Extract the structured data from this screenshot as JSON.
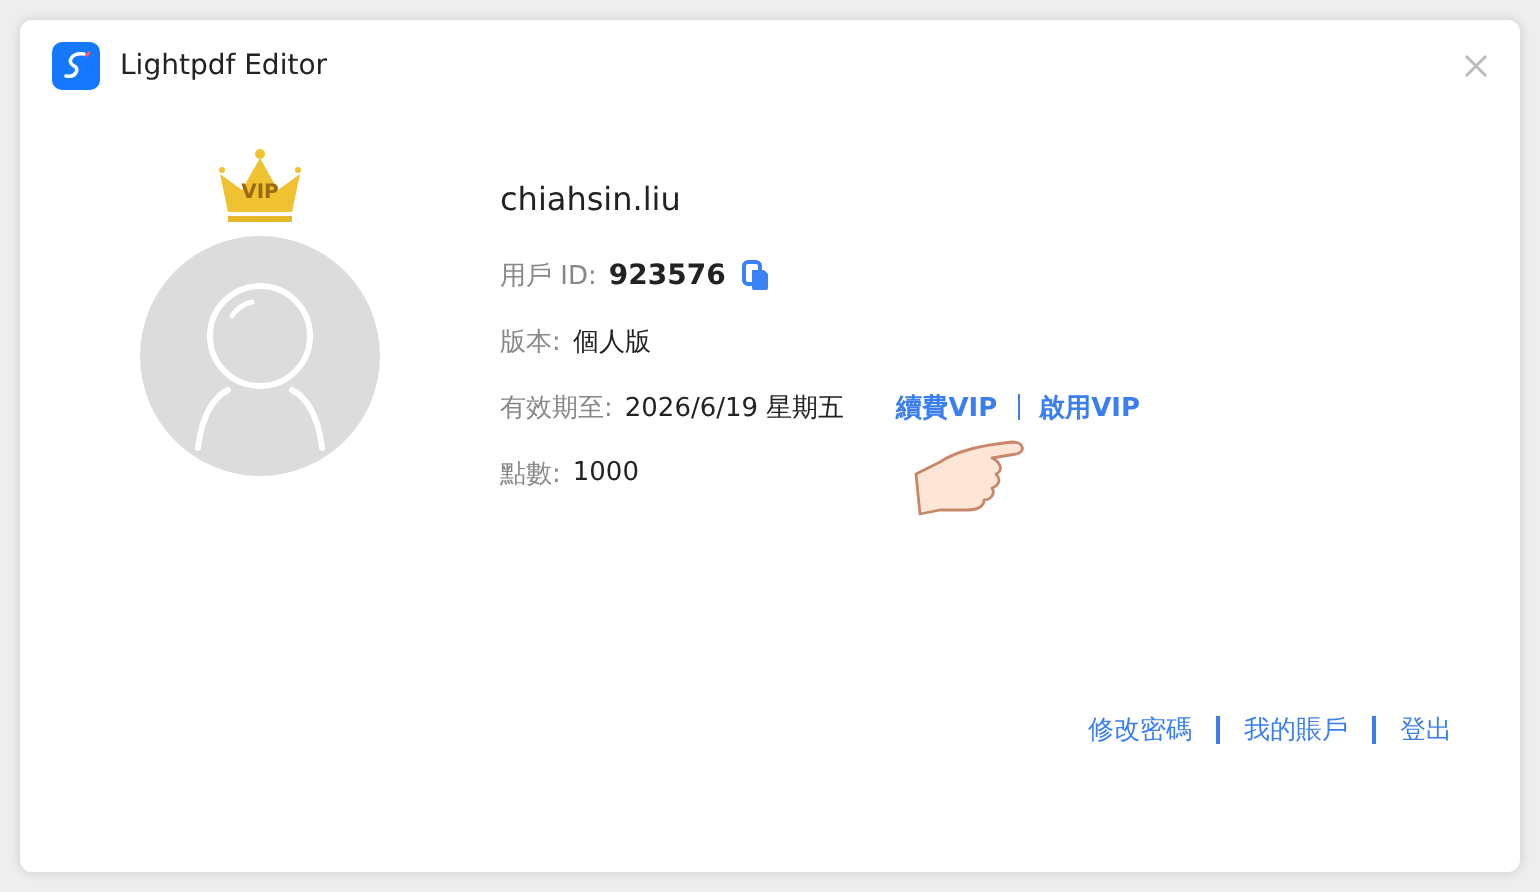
{
  "window": {
    "title": "Lightpdf Editor"
  },
  "account": {
    "username": "chiahsin.liu",
    "badge": "VIP",
    "fields": [
      {
        "kind": "id",
        "label": "用戶 ID:",
        "value": "923576"
      },
      {
        "kind": "plain",
        "label": "版本:",
        "value": "個人版"
      },
      {
        "kind": "expiry",
        "label": "有效期至:",
        "value": "2026/6/19 星期五",
        "links": [
          "續費VIP",
          "啟用VIP"
        ]
      },
      {
        "kind": "plain",
        "label": "點數:",
        "value": "1000"
      }
    ]
  },
  "footer_links": [
    "修改密碼",
    "我的賬戶",
    "登出"
  ]
}
